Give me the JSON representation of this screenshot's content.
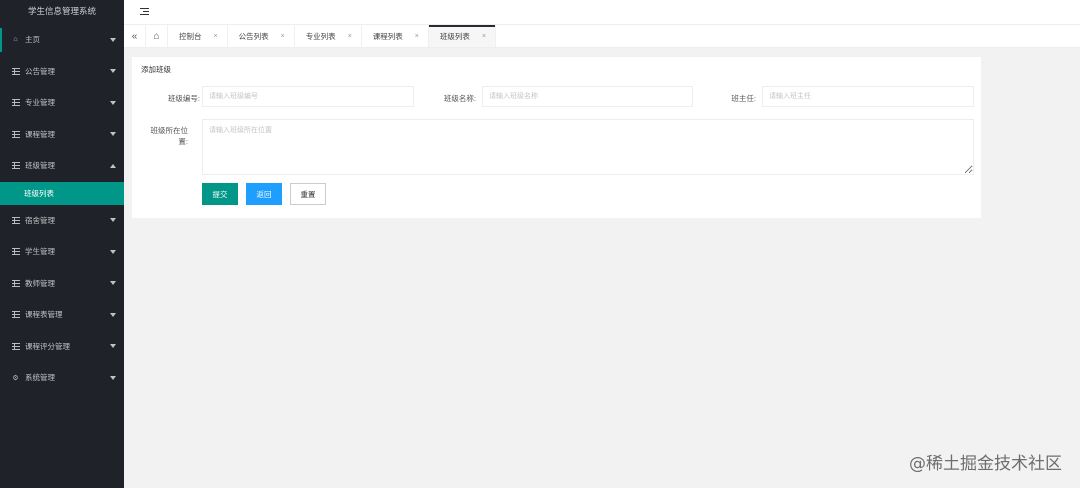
{
  "app_title": "学生信息管理系统",
  "sidebar": {
    "items": [
      {
        "label": "主页",
        "icon": "home-icon",
        "expanded": false
      },
      {
        "label": "公告管理",
        "icon": "list-icon",
        "expanded": false
      },
      {
        "label": "专业管理",
        "icon": "list-icon",
        "expanded": false
      },
      {
        "label": "课程管理",
        "icon": "list-icon",
        "expanded": false
      },
      {
        "label": "班级管理",
        "icon": "list-icon",
        "expanded": true
      },
      {
        "label": "宿舍管理",
        "icon": "list-icon",
        "expanded": false
      },
      {
        "label": "学生管理",
        "icon": "list-icon",
        "expanded": false
      },
      {
        "label": "教师管理",
        "icon": "list-icon",
        "expanded": false
      },
      {
        "label": "课程表管理",
        "icon": "list-icon",
        "expanded": false
      },
      {
        "label": "课程评分管理",
        "icon": "list-icon",
        "expanded": false
      },
      {
        "label": "系统管理",
        "icon": "gear-icon",
        "expanded": false
      }
    ],
    "submenu_active": "班级列表"
  },
  "tabs": [
    {
      "label": "控制台"
    },
    {
      "label": "公告列表"
    },
    {
      "label": "专业列表"
    },
    {
      "label": "课程列表"
    },
    {
      "label": "班级列表",
      "active": true
    }
  ],
  "tab_close_glyph": "×",
  "form": {
    "title": "添加班级",
    "class_no": {
      "label": "班级编号:",
      "placeholder": "请输入班级编号"
    },
    "class_name": {
      "label": "班级名称:",
      "placeholder": "请输入班级名称"
    },
    "head_teacher": {
      "label": "班主任:",
      "placeholder": "请输入班主任"
    },
    "location": {
      "label": "班级所在位置:",
      "placeholder": "请输入班级所在位置"
    },
    "submit_label": "提交",
    "back_label": "返回",
    "reset_label": "重置"
  },
  "watermark": "@稀土掘金技术社区",
  "colors": {
    "sidebar_bg": "#20222a",
    "accent": "#009688",
    "blue": "#1e9fff"
  }
}
